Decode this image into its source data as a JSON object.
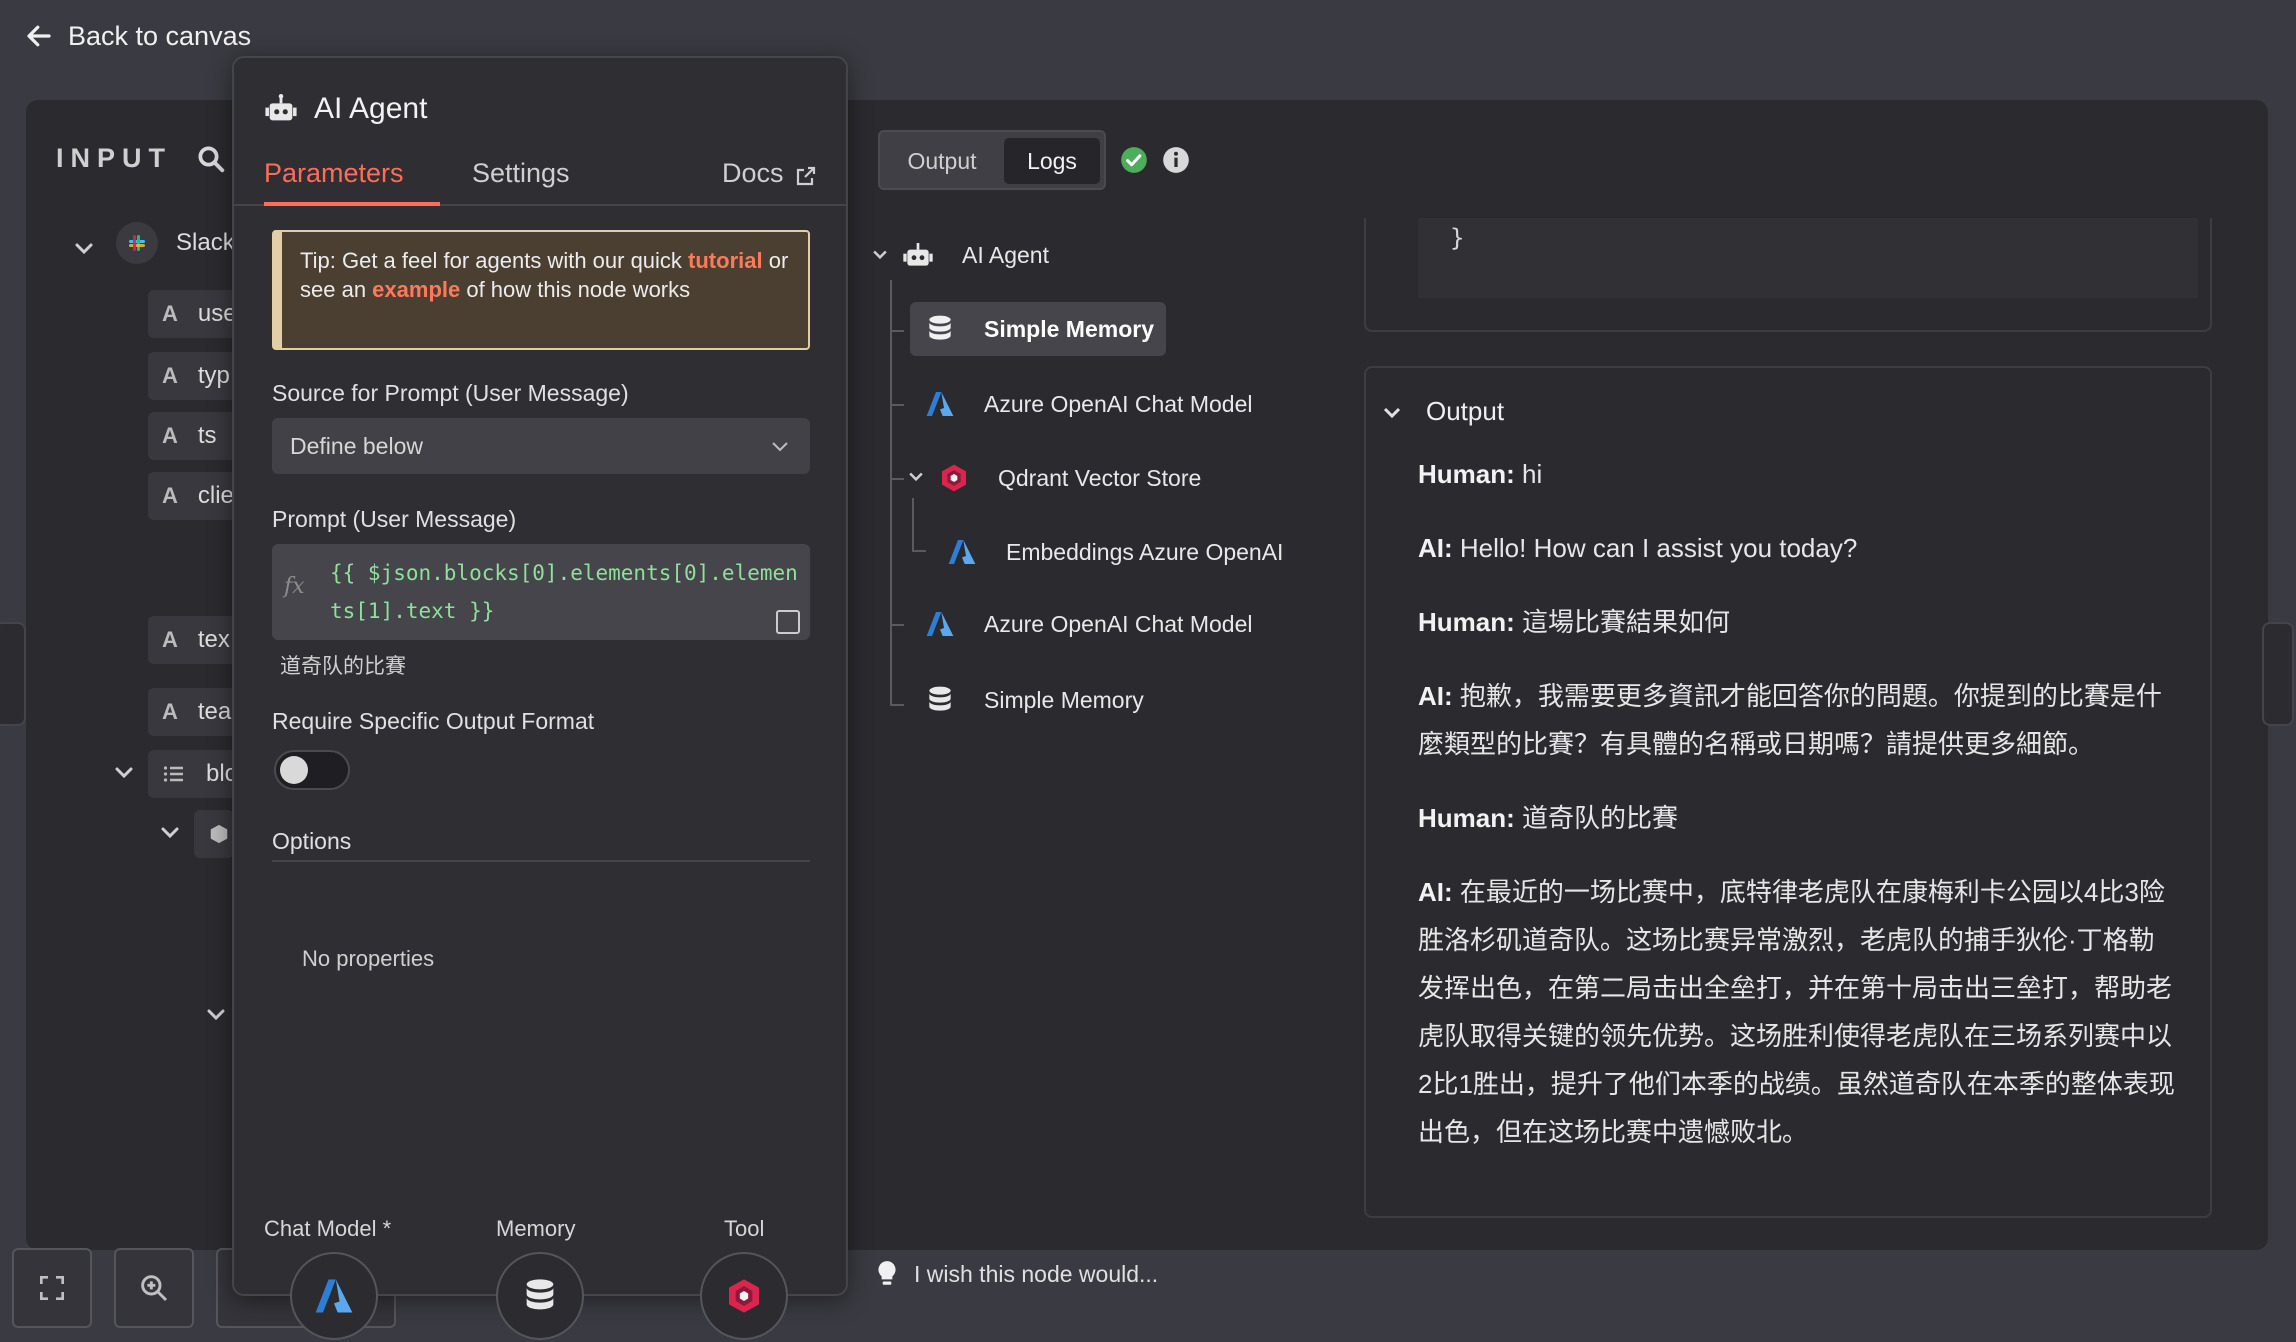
{
  "nav": {
    "back_label": "Back to canvas"
  },
  "input": {
    "title": "INPUT",
    "root_node": "Slack",
    "fields": [
      {
        "type": "A",
        "name": "use"
      },
      {
        "type": "A",
        "name": "typ"
      },
      {
        "type": "A",
        "name": "ts"
      },
      {
        "type": "A",
        "name": "clie"
      },
      {
        "type": "A",
        "name": "tex"
      },
      {
        "type": "A",
        "name": "tea"
      },
      {
        "type": "list",
        "name": "blo"
      }
    ]
  },
  "params": {
    "node_title": "AI Agent",
    "tabs": {
      "parameters": "Parameters",
      "settings": "Settings",
      "docs": "Docs"
    },
    "tip": {
      "pre": "Tip: Get a feel for agents with our quick ",
      "link1": "tutorial",
      "mid": " or see an ",
      "link2": "example",
      "post": " of how this node works"
    },
    "source_label": "Source for Prompt (User Message)",
    "source_value": "Define below",
    "prompt_label": "Prompt (User Message)",
    "prompt_fx": "fx",
    "prompt_expression": "{{ $json.blocks[0].elements[0].elements[1].text }}",
    "prompt_preview": "道奇队的比賽",
    "require_format_label": "Require Specific Output Format",
    "require_format_on": false,
    "options_label": "Options",
    "no_properties": "No properties",
    "sub_nodes": {
      "chat_model": "Chat Model *",
      "memory": "Memory",
      "tool": "Tool"
    }
  },
  "output": {
    "tabs": {
      "output": "Output",
      "logs": "Logs"
    },
    "active_tab": "Logs",
    "logs_tree": [
      {
        "label": "AI Agent",
        "icon": "robot-icon"
      },
      {
        "label": "Simple Memory",
        "icon": "database-icon",
        "selected": true
      },
      {
        "label": "Azure OpenAI Chat Model",
        "icon": "azure-icon"
      },
      {
        "label": "Qdrant Vector Store",
        "icon": "qdrant-icon"
      },
      {
        "label": "Embeddings Azure OpenAI",
        "icon": "azure-icon"
      },
      {
        "label": "Azure OpenAI Chat Model",
        "icon": "azure-icon"
      },
      {
        "label": "Simple Memory",
        "icon": "database-icon"
      }
    ],
    "json_tail": "}",
    "section_title": "Output",
    "messages": [
      {
        "role": "Human:",
        "text": " hi"
      },
      {
        "role": "AI:",
        "text": " Hello! How can I assist you today?"
      },
      {
        "role": "Human:",
        "text": " 這場比賽結果如何"
      },
      {
        "role": "AI:",
        "text": " 抱歉，我需要更多資訊才能回答你的問題。你提到的比賽是什麼類型的比賽？有具體的名稱或日期嗎？請提供更多細節。"
      },
      {
        "role": "Human:",
        "text": " 道奇队的比賽"
      },
      {
        "role": "AI:",
        "text": " 在最近的一场比赛中，底特律老虎队在康梅利卡公园以4比3险胜洛杉矶道奇队。这场比赛异常激烈，老虎队的捕手狄伦·丁格勒发挥出色，在第二局击出全垒打，并在第十局击出三垒打，帮助老虎队取得关键的领先优势。这场胜利使得老虎队在三场系列赛中以2比1胜出，提升了他们本季的战绩。虽然道奇队在本季的整体表现出色，但在这场比赛中遗憾败北。"
      }
    ]
  },
  "feedback": {
    "wish_label": "I wish this node would..."
  },
  "colors": {
    "accent": "#ff6d5a",
    "success": "#4cae5a",
    "code": "#8ee09a",
    "tip_border": "#e2cfa8"
  }
}
